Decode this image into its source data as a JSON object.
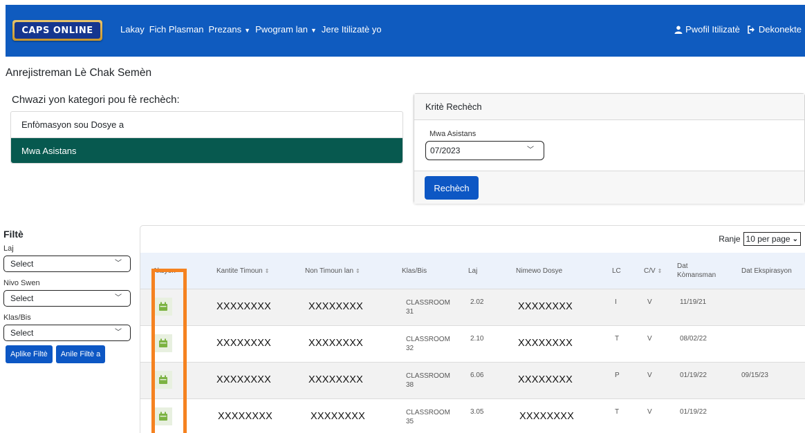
{
  "nav": {
    "logo_text": "CAPS ONLINE",
    "links": [
      "Lakay",
      "Fich Plasman",
      "Prezans",
      "Pwogram lan",
      "Jere Itilizatè yo"
    ],
    "profile": "Pwofil Itilizatè",
    "logout": "Dekonekte"
  },
  "page_title": "Anrejistreman Lè Chak Semèn",
  "category": {
    "prompt": "Chwazi yon kategori pou fè rechèch:",
    "items": [
      "Enfòmasyon sou Dosye a",
      "Mwa Asistans"
    ]
  },
  "criteria": {
    "header": "Kritè Rechèch",
    "month_label": "Mwa Asistans",
    "month_value": "07/2023",
    "search_button": "Rechèch"
  },
  "filters": {
    "title": "Filtè",
    "age_label": "Laj",
    "age_value": "Select",
    "level_label": "Nivo Swen",
    "level_value": "Select",
    "class_label": "Klas/Bis",
    "class_value": "Select",
    "apply_button": "Aplike Filtè",
    "clear_button": "Anile Filtè a"
  },
  "table": {
    "range_label": "Ranje",
    "range_value": "10 per page",
    "headers": {
      "action": "Aksyon",
      "count": "Kantite Timoun",
      "name": "Non Timoun lan",
      "class": "Klas/Bis",
      "age": "Laj",
      "case_number": "Nimewo Dosye",
      "lc": "LC",
      "cv": "C/V",
      "start_date": "Dat Kòmansman",
      "expiry_date": "Dat Ekspirasyon"
    },
    "rows": [
      {
        "count": "XXXXXXXX",
        "name": "XXXXXXXX",
        "class": "CLASSROOM 31",
        "age": "2.02",
        "case": "XXXXXXXX",
        "lc": "I",
        "cv": "V",
        "start": "11/19/21",
        "expiry": ""
      },
      {
        "count": "XXXXXXXX",
        "name": "XXXXXXXX",
        "class": "CLASSROOM 32",
        "age": "2.10",
        "case": "XXXXXXXX",
        "lc": "T",
        "cv": "V",
        "start": "08/02/22",
        "expiry": ""
      },
      {
        "count": "XXXXXXXX",
        "name": "XXXXXXXX",
        "class": "CLASSROOM 38",
        "age": "6.06",
        "case": "XXXXXXXX",
        "lc": "P",
        "cv": "V",
        "start": "01/19/22",
        "expiry": "09/15/23"
      },
      {
        "count": "XXXXXXXX",
        "name": "XXXXXXXX",
        "class": "CLASSROOM 35",
        "age": "3.05",
        "case": "XXXXXXXX",
        "lc": "T",
        "cv": "V",
        "start": "01/19/22",
        "expiry": ""
      }
    ]
  },
  "colors": {
    "navbar": "#0f5bbf",
    "active_category": "#07594f",
    "button": "#0d57c4",
    "highlight": "#f58220",
    "calendar_icon": "#7cb342"
  },
  "icons": {
    "profile": "user-icon",
    "logout": "logout-icon",
    "row_action": "calendar-icon"
  }
}
